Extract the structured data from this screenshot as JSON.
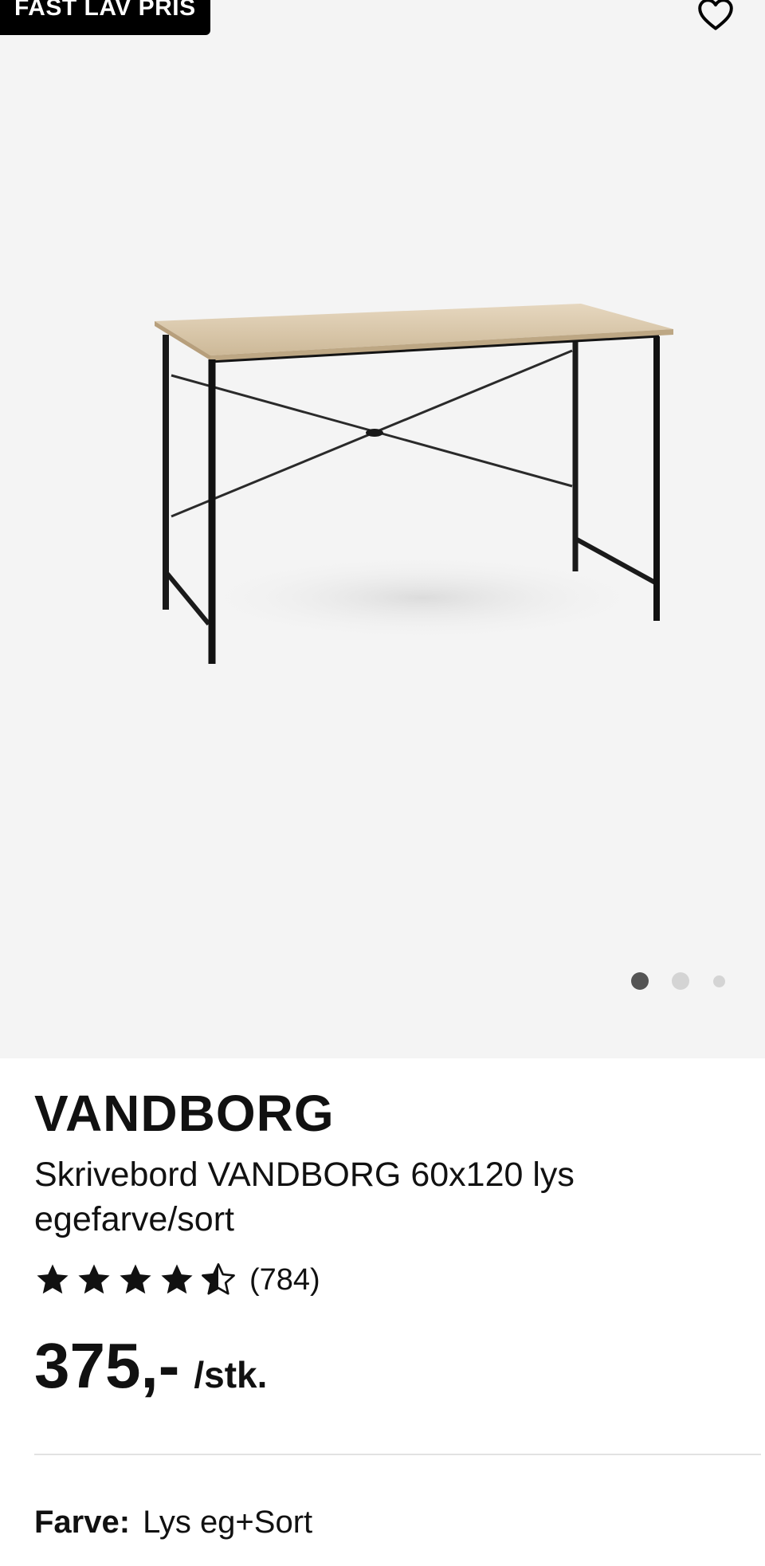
{
  "gallery": {
    "badge": "FAST LAV PRIS",
    "favorite_icon": "heart-outline-icon",
    "image_alt": "product-photo-desk",
    "image_count": 3,
    "active_image": 1,
    "background_color": "#f4f4f4"
  },
  "product": {
    "brand": "VANDBORG",
    "name": "Skrivebord VANDBORG 60x120 lys egefarve/sort",
    "rating": {
      "stars": 4.5,
      "max_stars": 5,
      "count": "(784)"
    },
    "price": "375,-",
    "unit": "/stk.",
    "color_label": "Farve:",
    "color_value": "Lys eg+Sort"
  },
  "colors": {
    "badge_bg": "#000000",
    "badge_text": "#ffffff",
    "star": "#111111",
    "dot_active": "#545454",
    "dot_inactive": "#d4d4d4"
  }
}
